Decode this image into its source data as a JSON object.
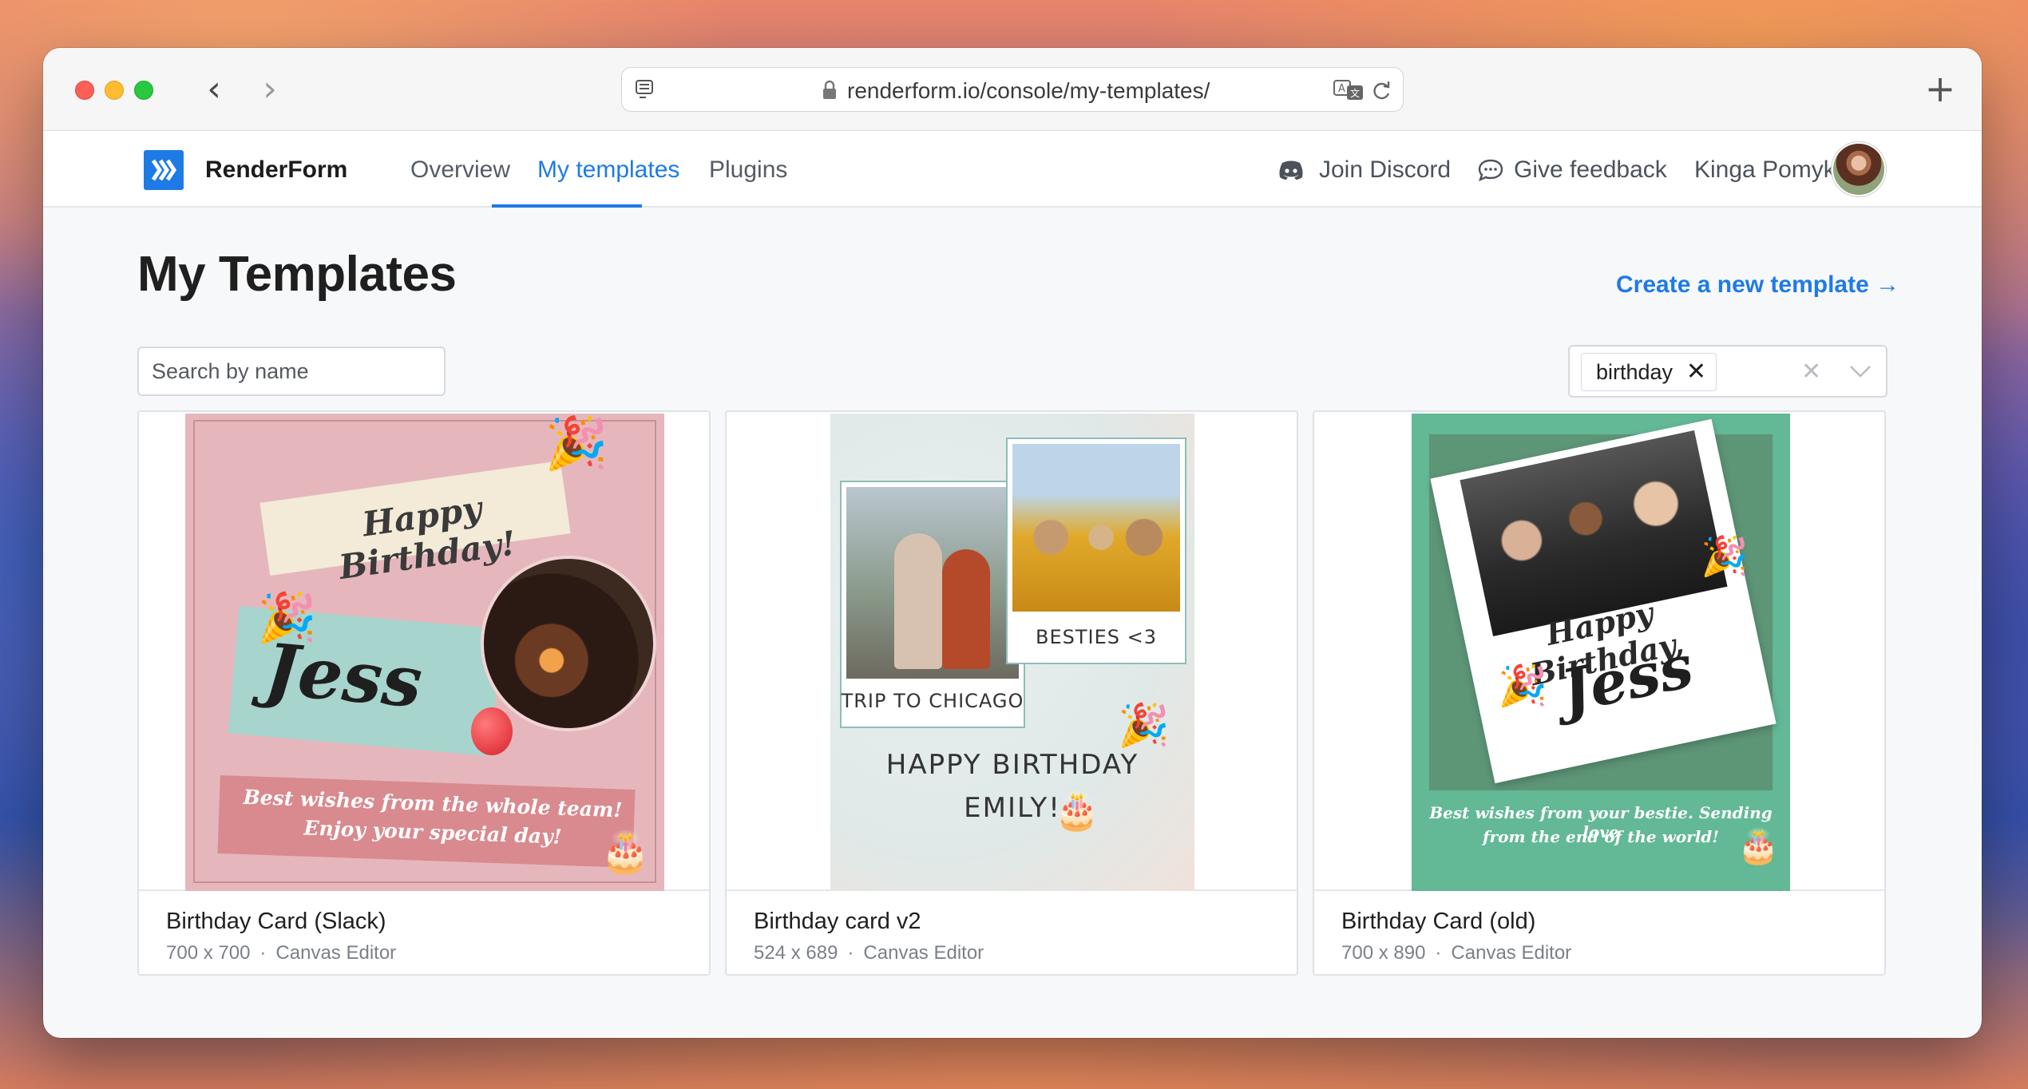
{
  "browser": {
    "url": "renderform.io/console/my-templates/",
    "new_tab_label": "+"
  },
  "app": {
    "brand": "RenderForm",
    "nav": [
      {
        "label": "Overview",
        "active": false
      },
      {
        "label": "My templates",
        "active": true
      },
      {
        "label": "Plugins",
        "active": false
      }
    ],
    "join_discord": "Join Discord",
    "give_feedback": "Give feedback",
    "user_name": "Kinga Pomykała",
    "accent_color": "#1e7be6"
  },
  "page": {
    "title": "My Templates",
    "create_link": "Create a new template →",
    "search_placeholder": "Search by name",
    "filter_tag": "birthday"
  },
  "templates": [
    {
      "name": "Birthday Card (Slack)",
      "size": "700 x 700",
      "editor": "Canvas Editor",
      "preview": {
        "heading": "Happy Birthday!",
        "name": "Jess",
        "message_line1": "Best wishes from the whole team!",
        "message_line2": "Enjoy your special day!"
      }
    },
    {
      "name": "Birthday card v2",
      "size": "524 x 689",
      "editor": "Canvas Editor",
      "preview": {
        "photo1_caption": "TRIP TO CHICAGO",
        "photo2_caption": "BESTIES <3",
        "greeting_line1": "HAPPY BIRTHDAY",
        "greeting_line2": "EMILY!"
      }
    },
    {
      "name": "Birthday Card (old)",
      "size": "700 x 890",
      "editor": "Canvas Editor",
      "preview": {
        "heading": "Happy Birthday,",
        "name": "Jess",
        "message_line1": "Best wishes from your bestie. Sending love",
        "message_line2": "from the end of the world!"
      }
    }
  ],
  "meta_separator": "·"
}
